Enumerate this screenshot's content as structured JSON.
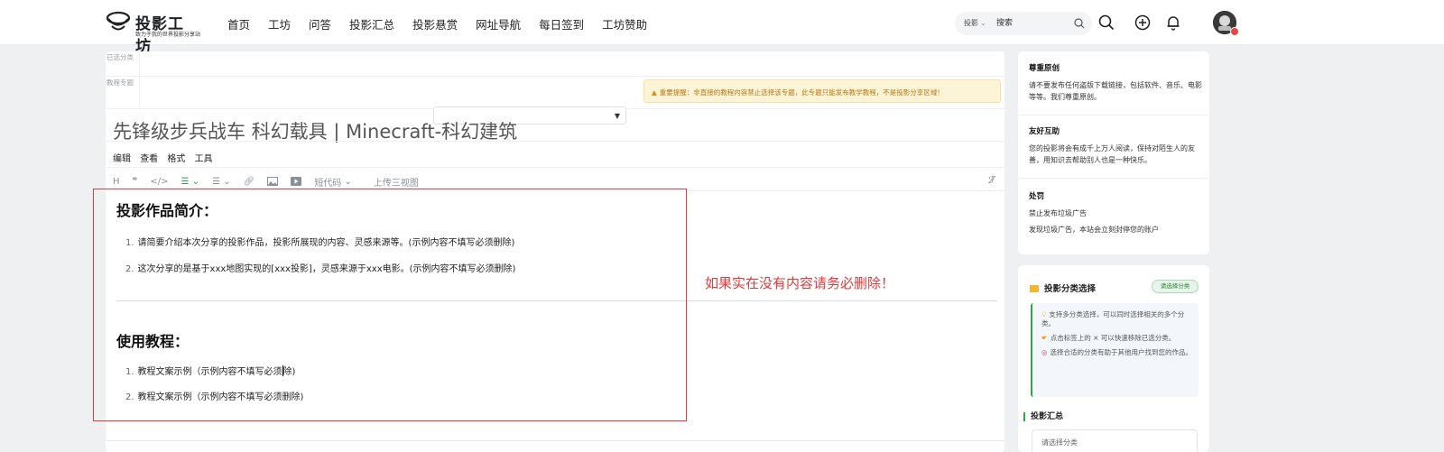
{
  "brand": {
    "title": "投影工坊",
    "subtitle": "致力于我的世界投影分享站"
  },
  "nav": [
    "首页",
    "工坊",
    "问答",
    "投影汇总",
    "投影悬赏",
    "网址导航",
    "每日签到",
    "工坊赞助"
  ],
  "search": {
    "scope": "投影",
    "placeholder": "搜索"
  },
  "top_icons": [
    "search-icon",
    "add-circle-icon",
    "bell-icon",
    "avatar"
  ],
  "editor": {
    "meta_labels": [
      "已选分类",
      "教程专题"
    ],
    "warning": "重要提醒：非直接的教程内容禁止选择该专题，此专题只能发布教学教程，不是投影分享区域！",
    "title": "先锋级步兵战车 科幻载具 | Minecraft-科幻建筑",
    "menu": [
      "编辑",
      "查看",
      "格式",
      "工具"
    ],
    "toolbar": {
      "shortcode": "短代码",
      "upload": "上传三视图"
    },
    "content": {
      "section1": "投影作品简介：",
      "items1": [
        "请简要介绍本次分享的投影作品，投影所展现的内容、灵感来源等。(示例内容不填写必须删除)",
        "这次分享的是基于xxx地图实现的[xxx投影]，灵感来源于xxx电影。(示例内容不填写必须删除)"
      ],
      "section2": "使用教程：",
      "item2_1_pre": "教程文案示例（示例内容不填写必须",
      "item2_1_post": "除)",
      "item2_2": "教程文案示例（示例内容不填写必须删除)"
    }
  },
  "annotation": "如果实在没有内容请务必删除！",
  "rules": [
    {
      "title": "尊重原创",
      "text": "请不要发布任何盗版下载链接，包括软件、音乐、电影等等。我们尊重原创。"
    },
    {
      "title": "友好互助",
      "text": "您的投影将会有成千上万人阅读，保持对陌生人的友善，用知识去帮助别人也是一种快乐。"
    },
    {
      "title": "处罚",
      "lines": [
        "禁止发布垃圾广告",
        "发现垃圾广告，本站会立刻封停您的账户"
      ]
    }
  ],
  "category": {
    "title": "投影分类选择",
    "button": "请选择分类",
    "tips": [
      "支持多分类选择，可以同时选择相关的多个分类。",
      "点击标签上的 × 可以快速移除已选分类。",
      "选择合适的分类有助于其他用户找到您的作品。"
    ],
    "summary_title": "投影汇总",
    "summary_placeholder": "请选择分类"
  },
  "colors": {
    "accent_green": "#2ea44f",
    "annotation_red": "#e23b3b",
    "warning_bg": "#fdf3d6"
  }
}
